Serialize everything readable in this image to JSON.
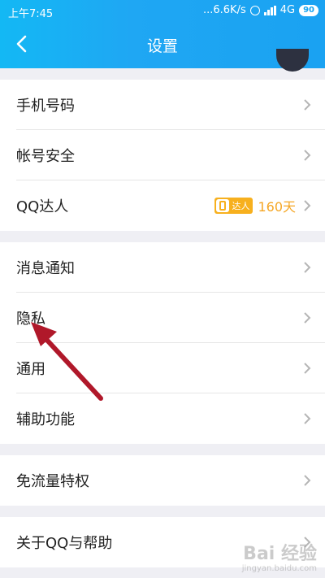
{
  "status_bar": {
    "time": "上午7:45",
    "net_speed": "...6.6K/s",
    "network": "4G",
    "battery": "90"
  },
  "header": {
    "title": "设置"
  },
  "groups": [
    {
      "items": [
        {
          "label": "手机号码"
        },
        {
          "label": "帐号安全"
        },
        {
          "label": "QQ达人",
          "badge": "达人",
          "days": "160天"
        }
      ]
    },
    {
      "items": [
        {
          "label": "消息通知"
        },
        {
          "label": "隐私"
        },
        {
          "label": "通用"
        },
        {
          "label": "辅助功能"
        }
      ]
    },
    {
      "items": [
        {
          "label": "免流量特权"
        }
      ]
    },
    {
      "items": [
        {
          "label": "关于QQ与帮助"
        }
      ]
    }
  ],
  "colors": {
    "header_gradient_start": "#13b8f4",
    "header_gradient_end": "#1aa2f2",
    "annotation_arrow": "#b0182a",
    "badge": "#f7b01e"
  },
  "watermark": {
    "text": "Bai 经验",
    "subtext": "jingyan.baidu.com"
  }
}
